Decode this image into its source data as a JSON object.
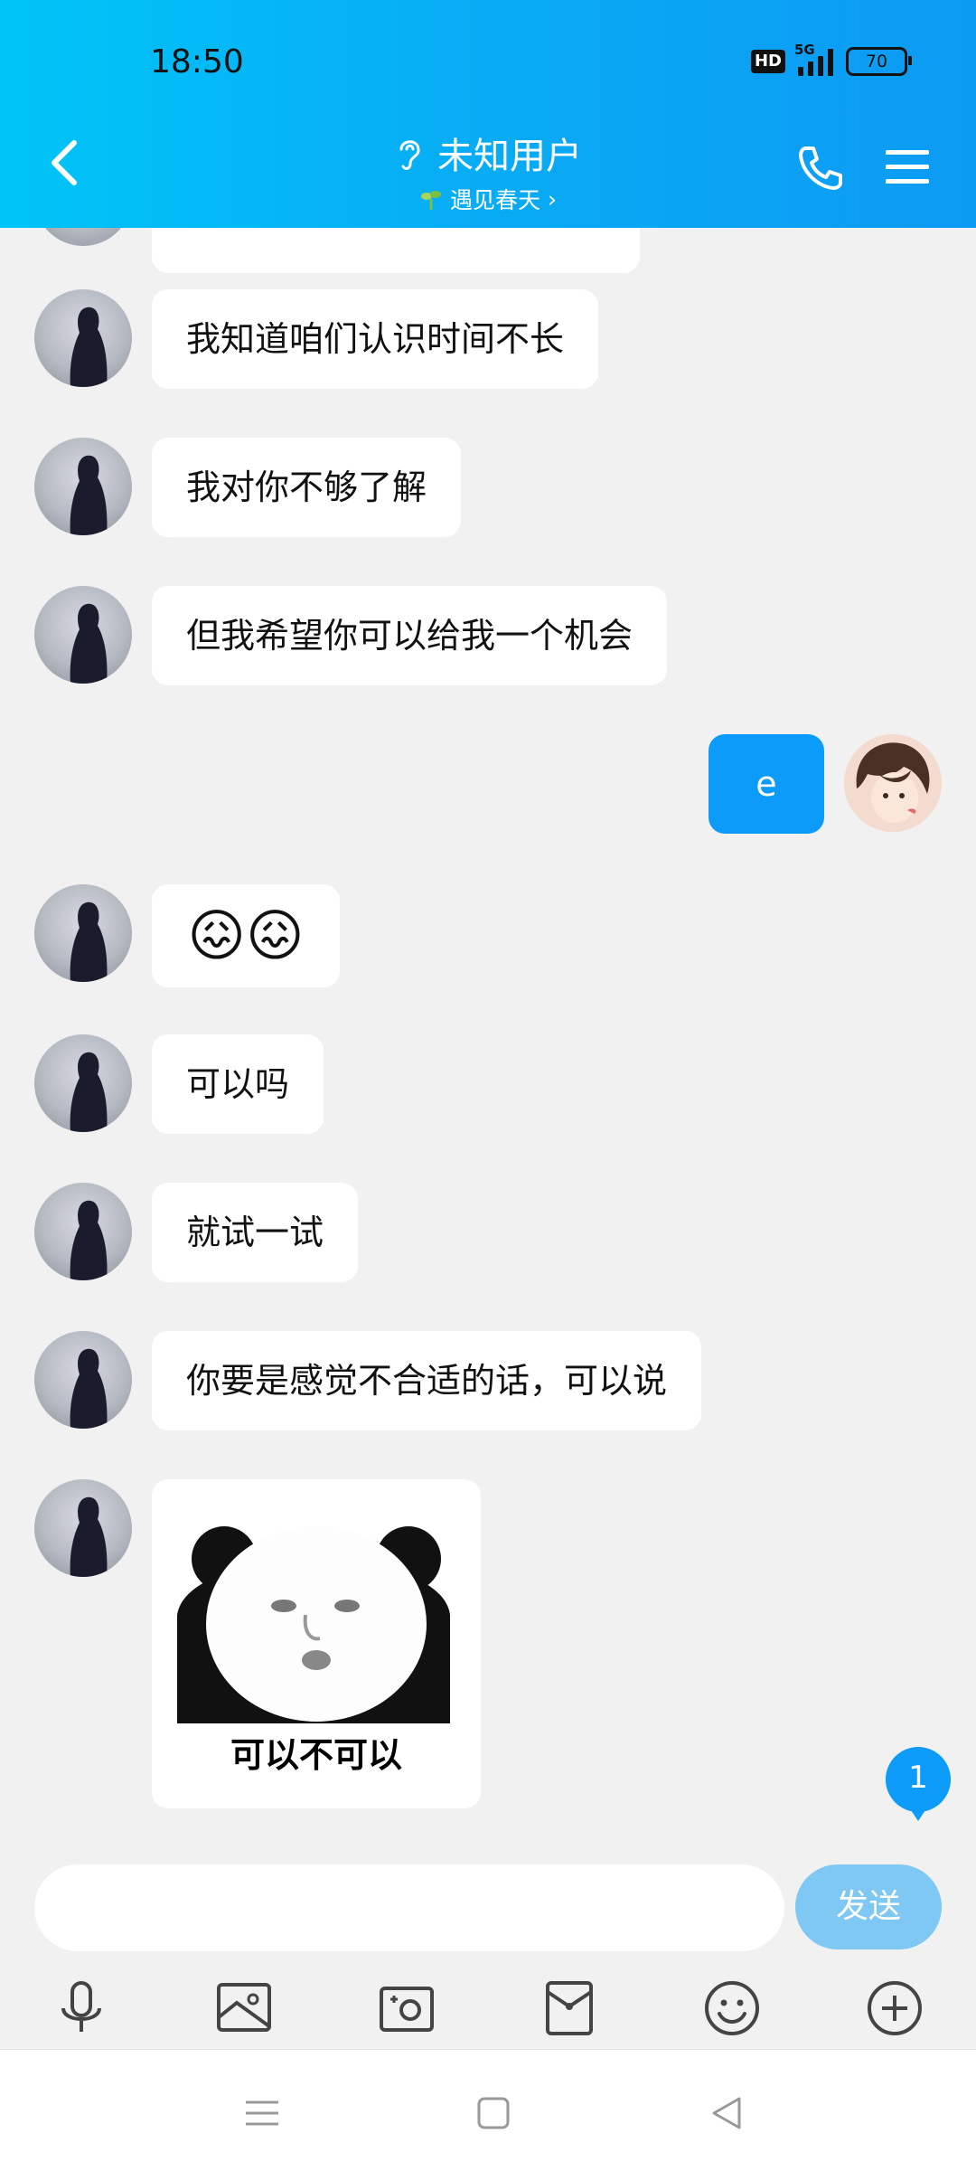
{
  "status_bar": {
    "time": "18:50",
    "hd_badge": "HD",
    "network": "5G",
    "battery": "70"
  },
  "header": {
    "title": "未知用户",
    "subtitle": "遇见春天",
    "subtitle_chevron": "›"
  },
  "messages": [
    {
      "from": "other",
      "text": "我知道咱们认识时间不长"
    },
    {
      "from": "other",
      "text": "我对你不够了解"
    },
    {
      "from": "other",
      "text": "但我希望你可以给我一个机会"
    },
    {
      "from": "me",
      "text": "e"
    },
    {
      "from": "other",
      "emoji": "😖😖"
    },
    {
      "from": "other",
      "text": "可以吗"
    },
    {
      "from": "other",
      "text": "就试一试"
    },
    {
      "from": "other",
      "text": "你要是感觉不合适的话，可以说"
    },
    {
      "from": "other",
      "sticker_caption": "可以不可以"
    }
  ],
  "unread_count": "1",
  "composer": {
    "input_value": "",
    "send_label": "发送"
  },
  "toolbar_icons": [
    "microphone-icon",
    "image-icon",
    "camera-icon",
    "red-packet-icon",
    "emoji-icon",
    "plus-icon"
  ],
  "nav_icons": [
    "menu-icon",
    "home-square-icon",
    "back-triangle-icon"
  ],
  "colors": {
    "header_gradient_start": "#00c4f7",
    "header_gradient_end": "#0c9bf3",
    "my_bubble": "#0d9bf9",
    "send_button": "#7ec8f3",
    "background": "#f1f1f1"
  }
}
